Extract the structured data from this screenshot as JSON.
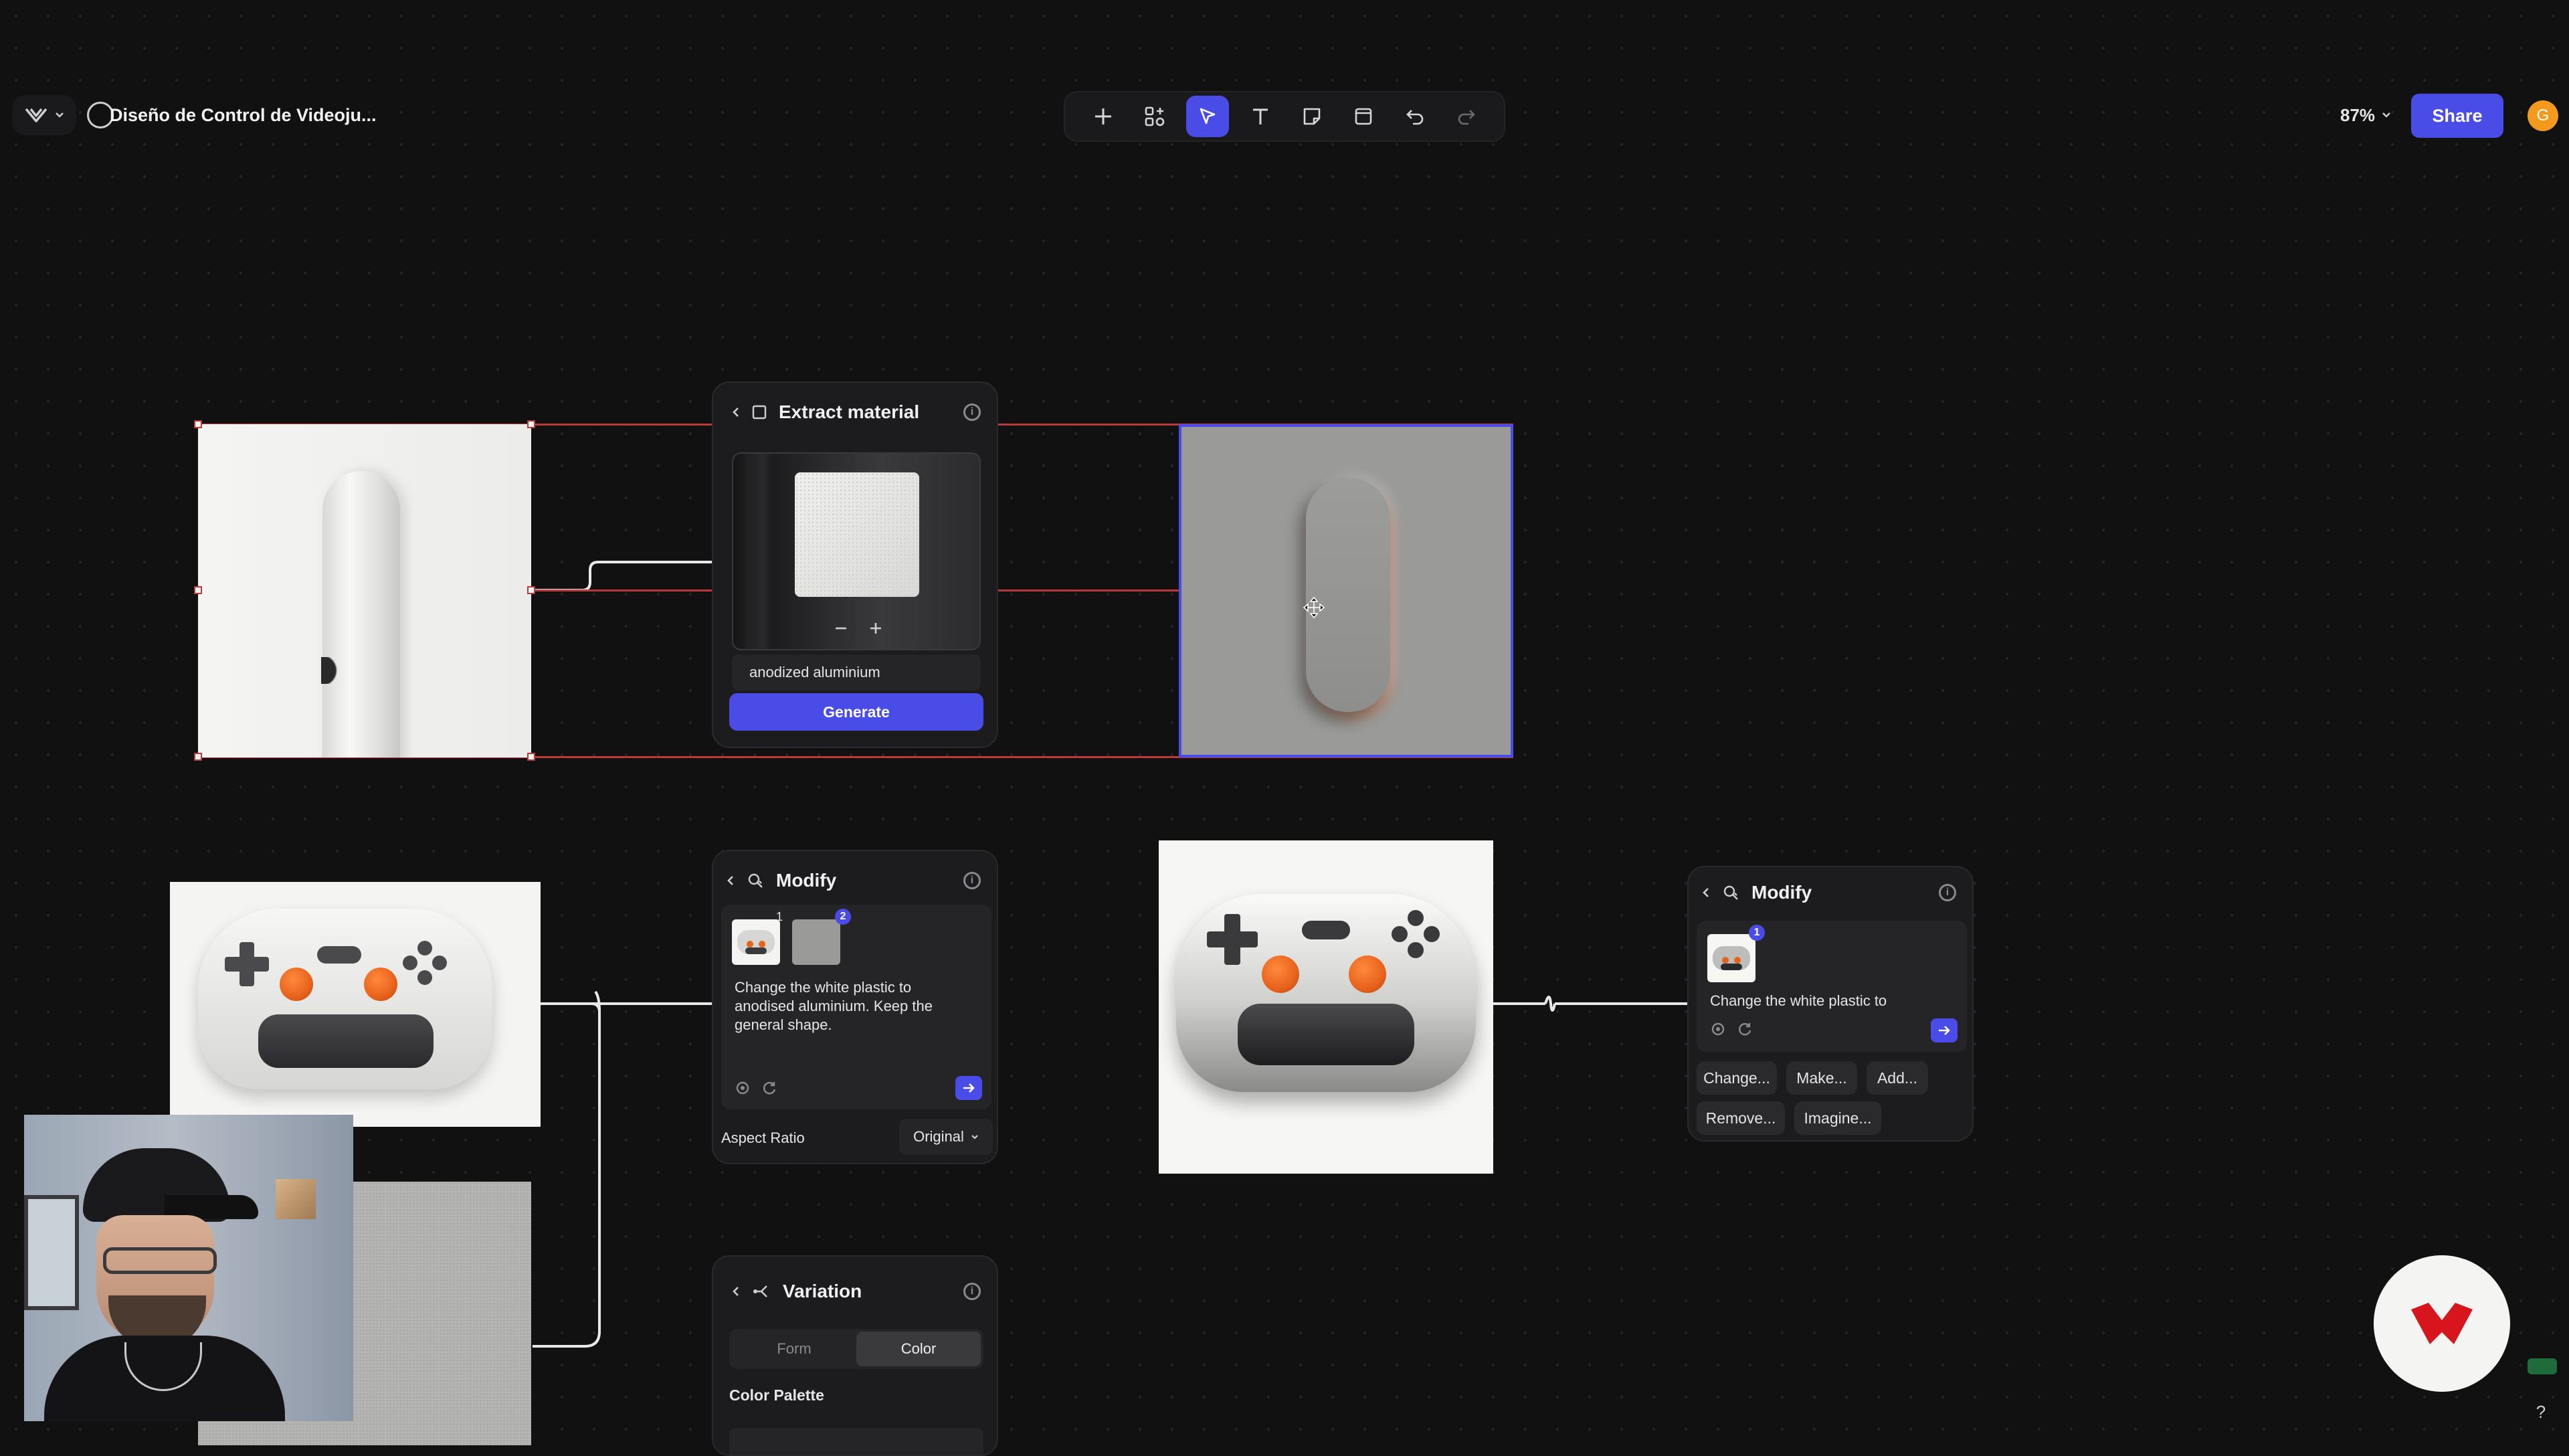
{
  "doc": {
    "title": "Diseño de Control de Videoju..."
  },
  "toolbar": {
    "zoom": "87%",
    "share": "Share",
    "avatar": "G"
  },
  "panels": {
    "extract": {
      "title": "Extract material",
      "input_value": "anodized aluminium",
      "generate": "Generate"
    },
    "modify1": {
      "title": "Modify",
      "badge1": "1",
      "badge2": "2",
      "prompt": "Change the white plastic to anodised aluminium. Keep the general shape.",
      "aspect_label": "Aspect Ratio",
      "aspect_value": "Original"
    },
    "modify2": {
      "title": "Modify",
      "badge1": "1",
      "prompt": "Change the white plastic to",
      "chips": [
        "Change...",
        "Make...",
        "Add...",
        "Remove...",
        "Imagine..."
      ]
    },
    "variation": {
      "title": "Variation",
      "tab_form": "Form",
      "tab_color": "Color",
      "palette_label": "Color Palette"
    }
  },
  "help": "?",
  "colors": {
    "accent": "#4a4ce8",
    "selection": "#b83a3a",
    "button_orange": "#e8621c",
    "brand_red": "#d8141c"
  }
}
